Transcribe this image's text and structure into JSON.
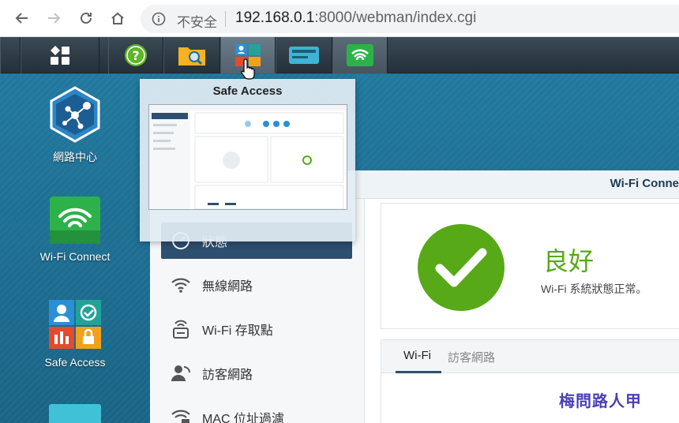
{
  "browser": {
    "insecure_label": "不安全",
    "url_host": "192.168.0.1",
    "url_rest": ":8000/webman/index.cgi"
  },
  "taskbar": {
    "items": [
      "main-menu-icon",
      "help-icon",
      "file-browser-icon",
      "safe-access-icon",
      "network-center-icon",
      "wifi-connect-icon"
    ]
  },
  "desktop": {
    "icons": [
      {
        "label": "網路中心",
        "icon": "network-center-icon"
      },
      {
        "label": "Wi-Fi Connect",
        "icon": "wifi-connect-icon"
      },
      {
        "label": "Safe Access",
        "icon": "safe-access-icon"
      }
    ]
  },
  "preview": {
    "title": "Safe Access"
  },
  "window": {
    "title": "Wi-Fi Conne",
    "sidebar": [
      {
        "label": "狀態",
        "icon": "status-icon"
      },
      {
        "label": "無線網路",
        "icon": "wifi-icon"
      },
      {
        "label": "Wi-Fi 存取點",
        "icon": "access-point-icon"
      },
      {
        "label": "訪客網路",
        "icon": "guest-network-icon"
      },
      {
        "label": "MAC 位址過濾",
        "icon": "mac-filter-icon"
      }
    ],
    "status": {
      "title": "良好",
      "desc": "Wi-Fi 系統狀態正常。"
    },
    "tabs": [
      "Wi-Fi",
      "訪客網路"
    ]
  },
  "watermark": "梅問路人甲",
  "colors": {
    "status_green": "#57a918",
    "active_nav": "#2d4f70"
  }
}
